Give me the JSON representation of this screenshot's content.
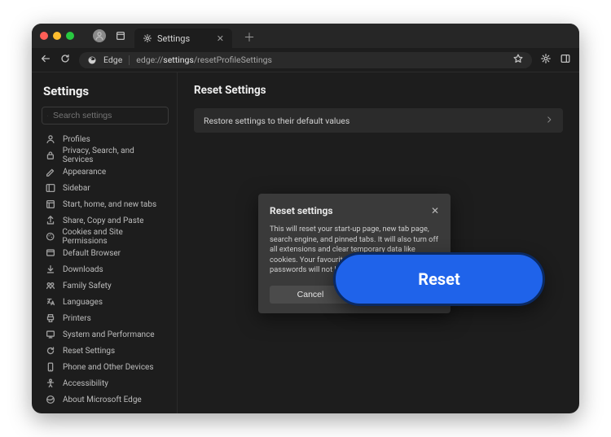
{
  "tab": {
    "title": "Settings"
  },
  "addressbar": {
    "brand": "Edge",
    "url_prefix": "edge://",
    "url_lit": "settings",
    "url_suffix": "/resetProfileSettings"
  },
  "sidebar": {
    "title": "Settings",
    "search_placeholder": "Search settings",
    "items": [
      {
        "icon": "profile-icon",
        "label": "Profiles"
      },
      {
        "icon": "lock-icon",
        "label": "Privacy, Search, and Services"
      },
      {
        "icon": "appearance-icon",
        "label": "Appearance"
      },
      {
        "icon": "sidebar-icon",
        "label": "Sidebar"
      },
      {
        "icon": "start-icon",
        "label": "Start, home, and new tabs"
      },
      {
        "icon": "share-icon",
        "label": "Share, Copy and Paste"
      },
      {
        "icon": "cookies-icon",
        "label": "Cookies and Site Permissions"
      },
      {
        "icon": "default-icon",
        "label": "Default Browser"
      },
      {
        "icon": "download-icon",
        "label": "Downloads"
      },
      {
        "icon": "family-icon",
        "label": "Family Safety"
      },
      {
        "icon": "language-icon",
        "label": "Languages"
      },
      {
        "icon": "printer-icon",
        "label": "Printers"
      },
      {
        "icon": "system-icon",
        "label": "System and Performance"
      },
      {
        "icon": "reset-icon",
        "label": "Reset Settings"
      },
      {
        "icon": "phone-icon",
        "label": "Phone and Other Devices"
      },
      {
        "icon": "accessibility-icon",
        "label": "Accessibility"
      },
      {
        "icon": "edge-icon",
        "label": "About Microsoft Edge"
      }
    ]
  },
  "main": {
    "title": "Reset Settings",
    "row_label": "Restore settings to their default values"
  },
  "dialog": {
    "title": "Reset settings",
    "body": "This will reset your start-up page, new tab page, search engine, and pinned tabs. It will also turn off all extensions and clear temporary data like cookies. Your favourites, history and saved passwords will not be cleared.",
    "cancel": "Cancel",
    "reset": "Reset"
  },
  "callout": {
    "label": "Reset"
  }
}
